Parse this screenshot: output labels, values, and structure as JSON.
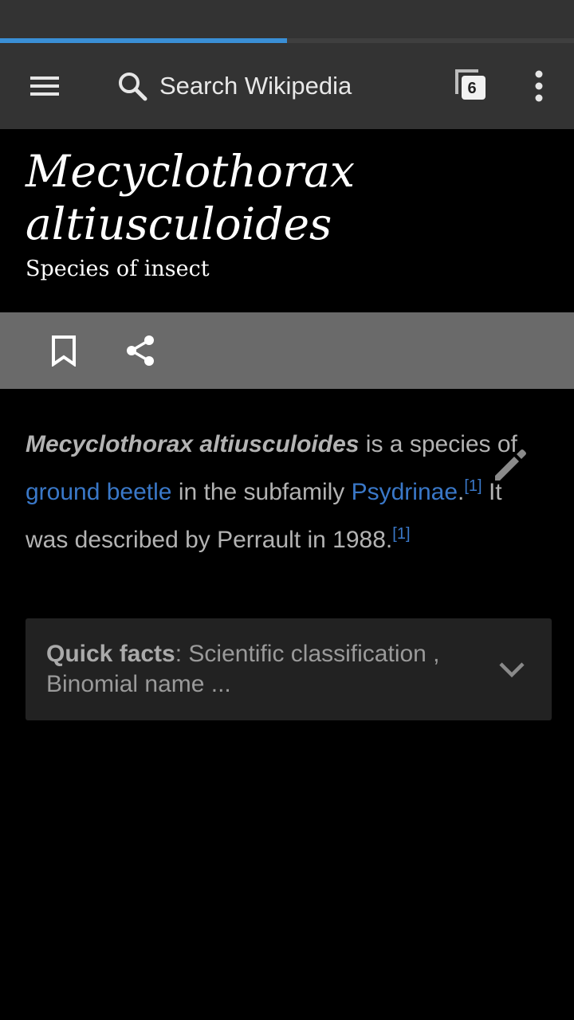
{
  "progress": {
    "fraction": 0.5,
    "color": "#3a8fd6"
  },
  "toolbar": {
    "menu_icon": "hamburger-menu-icon",
    "search_icon": "search-icon",
    "search_placeholder": "Search Wikipedia",
    "tabs_count": "6",
    "overflow_icon": "more-vertical-icon"
  },
  "article": {
    "title": "Mecyclothorax altiusculoides",
    "description": "Species of insect",
    "actions": {
      "bookmark_icon": "bookmark-icon",
      "share_icon": "share-icon"
    },
    "lead": {
      "bold_name": "Mecyclothorax altiusculoides",
      "text_1": " is a species of ",
      "link_1": "ground beetle",
      "text_2": " in the subfamily ",
      "link_2": "Psydrinae",
      "text_3": ".",
      "ref_1": "[1]",
      "text_4": " It was described by Perrault in 1988.",
      "ref_2": "[1]"
    },
    "edit_icon": "pencil-icon",
    "quick_facts": {
      "label": "Quick facts",
      "summary": ": Scientific classification , Binomial name ..."
    }
  },
  "colors": {
    "link": "#3a78c8",
    "toolbar_bg": "#333333",
    "action_bar_bg": "#6a6a6a"
  }
}
